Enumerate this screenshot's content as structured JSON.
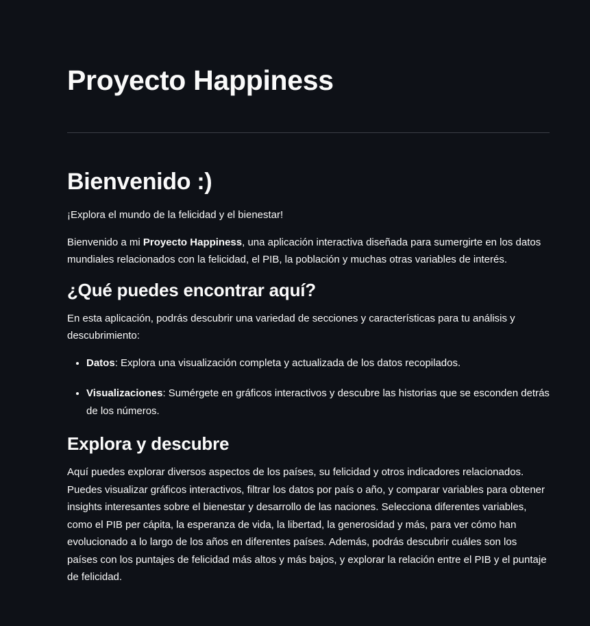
{
  "page": {
    "title": "Proyecto Happiness"
  },
  "welcome": {
    "heading": "Bienvenido :)",
    "tagline": "¡Explora el mundo de la felicidad y el bienestar!",
    "intro_prefix": "Bienvenido a mi ",
    "intro_bold": "Proyecto Happiness",
    "intro_suffix": ", una aplicación interactiva diseñada para sumergirte en los datos mundiales relacionados con la felicidad, el PIB, la población y muchas otras variables de interés."
  },
  "features": {
    "heading": "¿Qué puedes encontrar aquí?",
    "intro": "En esta aplicación, podrás descubrir una variedad de secciones y características para tu análisis y descubrimiento:",
    "items": [
      {
        "name": "Datos",
        "description": ": Explora una visualización completa y actualizada de los datos recopilados."
      },
      {
        "name": "Visualizaciones",
        "description": ": Sumérgete en gráficos interactivos y descubre las historias que se esconden detrás de los números."
      }
    ]
  },
  "explore": {
    "heading": "Explora y descubre",
    "body": "Aquí puedes explorar diversos aspectos de los países, su felicidad y otros indicadores relacionados. Puedes visualizar gráficos interactivos, filtrar los datos por país o año, y comparar variables para obtener insights interesantes sobre el bienestar y desarrollo de las naciones. Selecciona diferentes variables, como el PIB per cápita, la esperanza de vida, la libertad, la generosidad y más, para ver cómo han evolucionado a lo largo de los años en diferentes países. Además, podrás descubrir cuáles son los países con los puntajes de felicidad más altos y más bajos, y explorar la relación entre el PIB y el puntaje de felicidad."
  },
  "theme": {
    "background": "#0e1117",
    "text": "#fafafa",
    "divider": "#3b3f47"
  }
}
